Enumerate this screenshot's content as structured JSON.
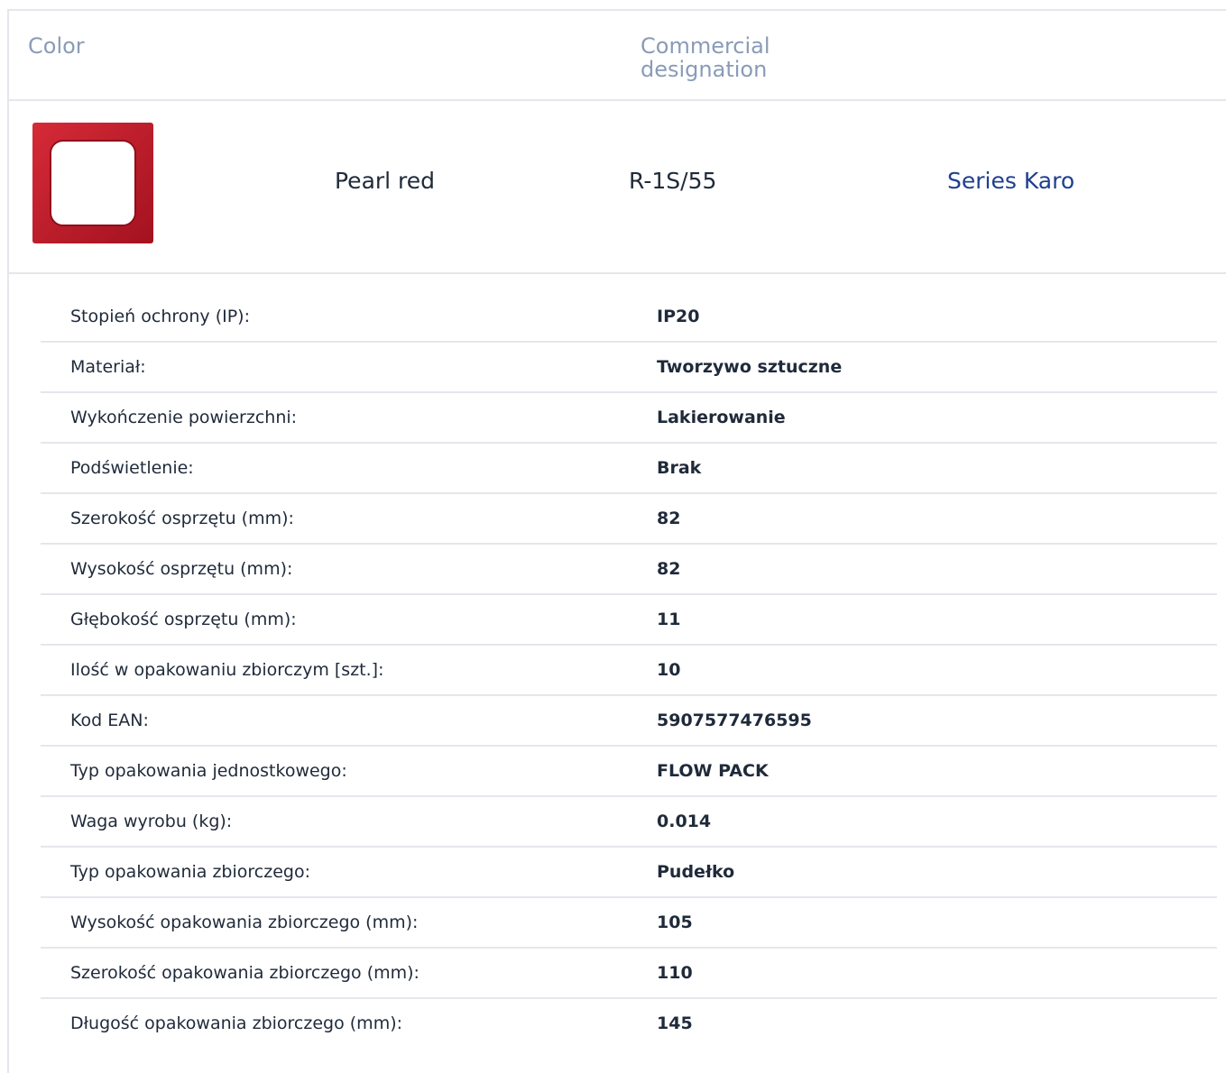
{
  "header": {
    "color_label": "Color",
    "commercial_designation_label": "Commercial designation"
  },
  "product": {
    "swatch_icon": "red-frame-icon",
    "color_name": "Pearl red",
    "designation": "R-1S/55",
    "series_link": "Series Karo",
    "colors": {
      "frame": "#c92230",
      "frame_dark": "#a3121f",
      "link": "#1e3f8f"
    }
  },
  "specs": [
    {
      "label": "Stopień ochrony (IP):",
      "value": "IP20"
    },
    {
      "label": "Materiał:",
      "value": "Tworzywo sztuczne"
    },
    {
      "label": "Wykończenie powierzchni:",
      "value": "Lakierowanie"
    },
    {
      "label": "Podświetlenie:",
      "value": "Brak"
    },
    {
      "label": "Szerokość osprzętu (mm):",
      "value": "82"
    },
    {
      "label": "Wysokość osprzętu (mm):",
      "value": "82"
    },
    {
      "label": "Głębokość osprzętu (mm):",
      "value": "11"
    },
    {
      "label": "Ilość w opakowaniu zbiorczym [szt.]:",
      "value": "10"
    },
    {
      "label": "Kod EAN:",
      "value": "5907577476595"
    },
    {
      "label": "Typ opakowania jednostkowego:",
      "value": "FLOW PACK"
    },
    {
      "label": "Waga wyrobu (kg):",
      "value": "0.014"
    },
    {
      "label": "Typ opakowania zbiorczego:",
      "value": "Pudełko"
    },
    {
      "label": "Wysokość opakowania zbiorczego (mm):",
      "value": "105"
    },
    {
      "label": "Szerokość opakowania zbiorczego (mm):",
      "value": "110"
    },
    {
      "label": "Długość opakowania zbiorczego (mm):",
      "value": "145"
    }
  ]
}
